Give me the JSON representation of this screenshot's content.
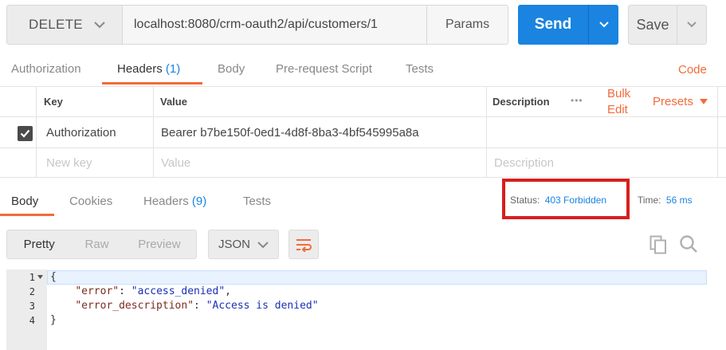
{
  "request": {
    "method": "DELETE",
    "url": "localhost:8080/crm-oauth2/api/customers/1",
    "params_label": "Params",
    "send_label": "Send",
    "save_label": "Save"
  },
  "request_tabs": {
    "authorization": "Authorization",
    "headers": "Headers",
    "headers_count": "(1)",
    "body": "Body",
    "prerequest": "Pre-request Script",
    "tests": "Tests",
    "code": "Code"
  },
  "headers_table": {
    "col_key": "Key",
    "col_value": "Value",
    "col_description": "Description",
    "more": "•••",
    "bulk_edit_line1": "Bulk",
    "bulk_edit_line2": "Edit",
    "presets": "Presets",
    "rows": [
      {
        "checked": true,
        "key": "Authorization",
        "value": "Bearer b7be150f-0ed1-4d8f-8ba3-4bf545995a8a",
        "description": ""
      }
    ],
    "new_key_placeholder": "New key",
    "new_value_placeholder": "Value",
    "new_description_placeholder": "Description"
  },
  "response_tabs": {
    "body": "Body",
    "cookies": "Cookies",
    "headers": "Headers",
    "headers_count": "(9)",
    "tests": "Tests"
  },
  "status": {
    "status_label": "Status:",
    "status_value": "403 Forbidden",
    "time_label": "Time:",
    "time_value": "56 ms"
  },
  "body_toolbar": {
    "pretty": "Pretty",
    "raw": "Raw",
    "preview": "Preview",
    "format": "JSON"
  },
  "editor": {
    "line_numbers": [
      "1",
      "2",
      "3",
      "4"
    ],
    "line1": "{",
    "line2_key": "\"error\"",
    "line2_sep": ": ",
    "line2_val": "\"access_denied\"",
    "line2_end": ",",
    "line3_key": "\"error_description\"",
    "line3_sep": ": ",
    "line3_val": "\"Access is denied\"",
    "line4": "}"
  },
  "colors": {
    "accent_blue": "#1a84e0",
    "accent_orange": "#f26b3a",
    "highlight_red": "#d81e1e"
  }
}
